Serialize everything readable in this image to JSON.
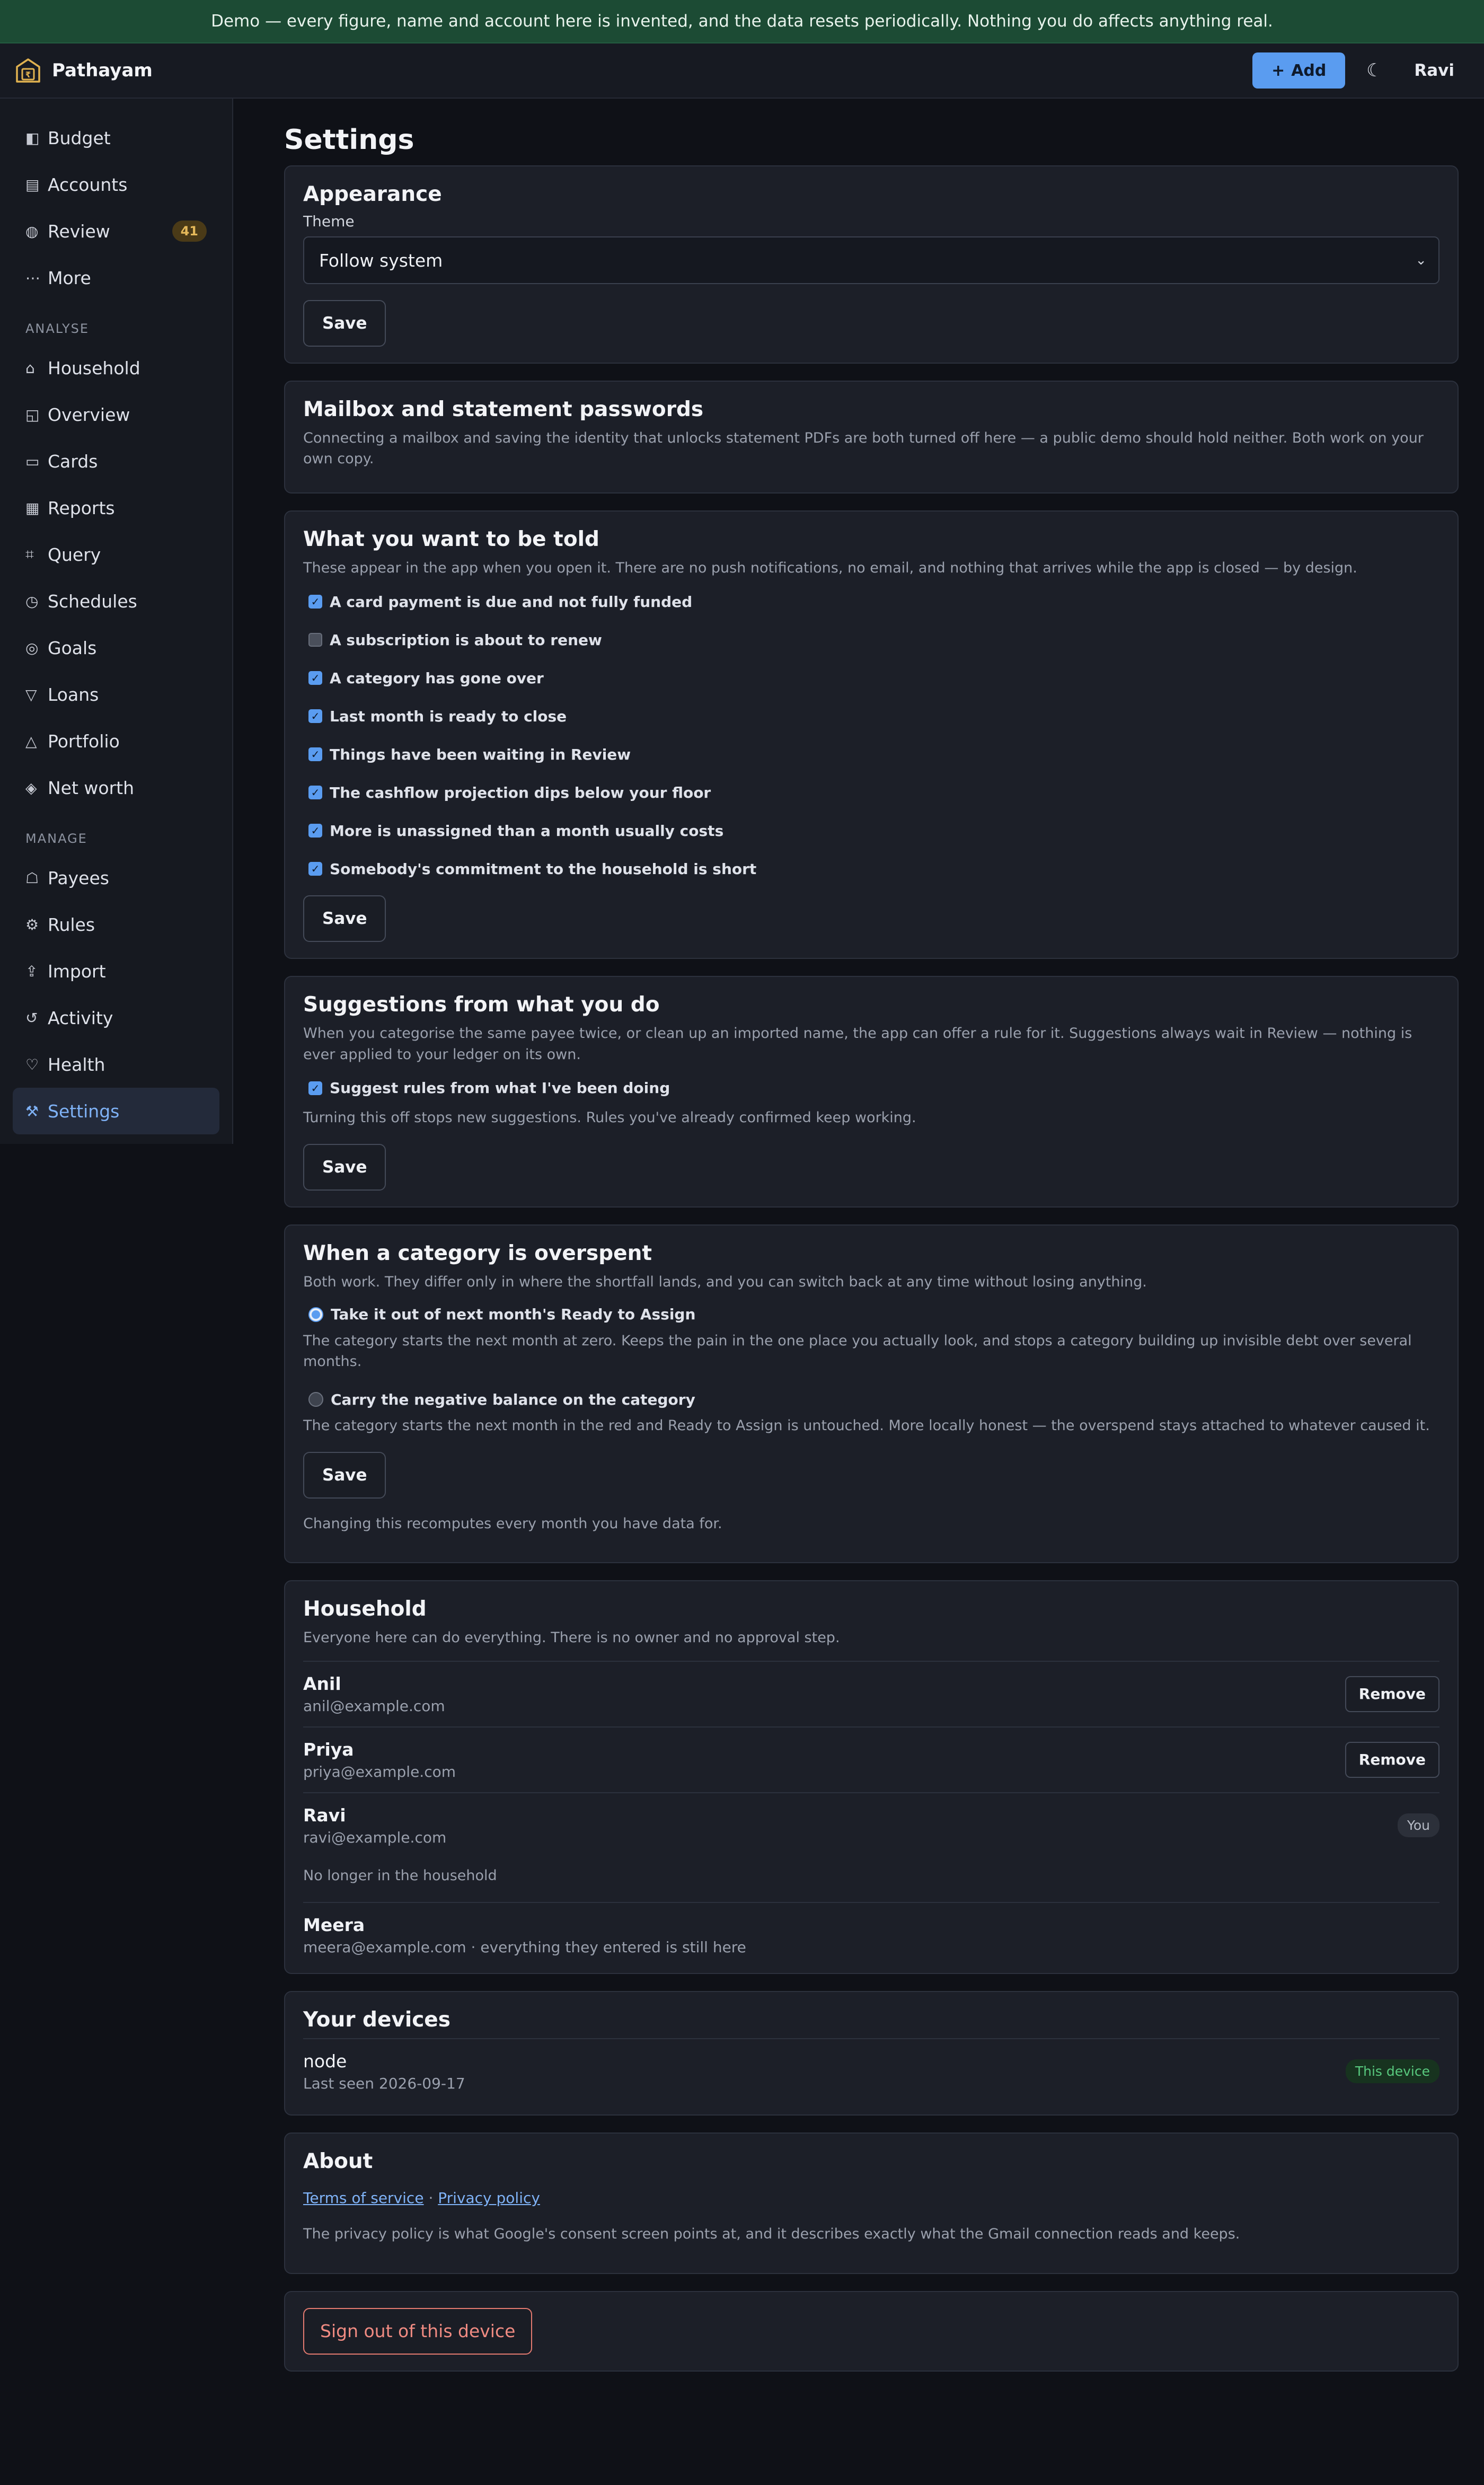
{
  "banner": "Demo — every figure, name and account here is invented, and the data resets periodically. Nothing you do affects anything real.",
  "topbar": {
    "brand": "Pathayam",
    "add_label": "Add",
    "theme_icon": "moon-icon",
    "user": "Ravi"
  },
  "sidebar": {
    "items": [
      {
        "label": "Budget",
        "icon": "budget-icon",
        "glyph": "◧"
      },
      {
        "label": "Accounts",
        "icon": "accounts-icon",
        "glyph": "▤"
      },
      {
        "label": "Review",
        "icon": "review-icon",
        "glyph": "◍",
        "badge": "41"
      },
      {
        "label": "More",
        "icon": "more-icon",
        "glyph": "⋯"
      }
    ],
    "analyse_heading": "ANALYSE",
    "analyse": [
      {
        "label": "Household",
        "glyph": "⌂"
      },
      {
        "label": "Overview",
        "glyph": "◱"
      },
      {
        "label": "Cards",
        "glyph": "▭"
      },
      {
        "label": "Reports",
        "glyph": "▦"
      },
      {
        "label": "Query",
        "glyph": "⌗"
      },
      {
        "label": "Schedules",
        "glyph": "◷"
      },
      {
        "label": "Goals",
        "glyph": "◎"
      },
      {
        "label": "Loans",
        "glyph": "▽"
      },
      {
        "label": "Portfolio",
        "glyph": "△"
      },
      {
        "label": "Net worth",
        "glyph": "◈"
      }
    ],
    "manage_heading": "MANAGE",
    "manage": [
      {
        "label": "Payees",
        "glyph": "☖"
      },
      {
        "label": "Rules",
        "glyph": "⚙"
      },
      {
        "label": "Import",
        "glyph": "⇪"
      },
      {
        "label": "Activity",
        "glyph": "↺"
      },
      {
        "label": "Health",
        "glyph": "♡"
      },
      {
        "label": "Settings",
        "glyph": "⚒",
        "active": true
      }
    ]
  },
  "page": {
    "title": "Settings",
    "appearance": {
      "title": "Appearance",
      "theme_label": "Theme",
      "theme_value": "Follow system",
      "save": "Save"
    },
    "mailbox": {
      "title": "Mailbox and statement passwords",
      "description": "Connecting a mailbox and saving the identity that unlocks statement PDFs are both turned off here — a public demo should hold neither. Both work on your own copy."
    },
    "notify": {
      "title": "What you want to be told",
      "description": "These appear in the app when you open it. There are no push notifications, no email, and nothing that arrives while the app is closed — by design.",
      "options": [
        {
          "label": "A card payment is due and not fully funded",
          "checked": true
        },
        {
          "label": "A subscription is about to renew",
          "checked": false
        },
        {
          "label": "A category has gone over",
          "checked": true
        },
        {
          "label": "Last month is ready to close",
          "checked": true
        },
        {
          "label": "Things have been waiting in Review",
          "checked": true
        },
        {
          "label": "The cashflow projection dips below your floor",
          "checked": true
        },
        {
          "label": "More is unassigned than a month usually costs",
          "checked": true
        },
        {
          "label": "Somebody's commitment to the household is short",
          "checked": true
        }
      ],
      "save": "Save"
    },
    "suggestions": {
      "title": "Suggestions from what you do",
      "description": "When you categorise the same payee twice, or clean up an imported name, the app can offer a rule for it. Suggestions always wait in Review — nothing is ever applied to your ledger on its own.",
      "option": "Suggest rules from what I've been doing",
      "note": "Turning this off stops new suggestions. Rules you've already confirmed keep working.",
      "save": "Save"
    },
    "overspent": {
      "title": "When a category is overspent",
      "description": "Both work. They differ only in where the shortfall lands, and you can switch back at any time without losing anything.",
      "option1": "Take it out of next month's Ready to Assign",
      "option1_desc": "The category starts the next month at zero. Keeps the pain in the one place you actually look, and stops a category building up invisible debt over several months.",
      "option2": "Carry the negative balance on the category",
      "option2_desc": "The category starts the next month in the red and Ready to Assign is untouched. More locally honest — the overspend stays attached to whatever caused it.",
      "save": "Save",
      "note": "Changing this recomputes every month you have data for."
    },
    "household": {
      "title": "Household",
      "description": "Everyone here can do everything. There is no owner and no approval step.",
      "members": [
        {
          "name": "Anil",
          "email": "anil@example.com",
          "action": "Remove"
        },
        {
          "name": "Priya",
          "email": "priya@example.com",
          "action": "Remove"
        },
        {
          "name": "Ravi",
          "email": "ravi@example.com",
          "badge": "You"
        }
      ],
      "former_heading": "No longer in the household",
      "former": {
        "name": "Meera",
        "detail": "meera@example.com · everything they entered is still here"
      }
    },
    "devices": {
      "title": "Your devices",
      "name": "node",
      "last_seen": "Last seen 2026-09-17",
      "badge": "This device"
    },
    "about": {
      "title": "About",
      "terms": "Terms of service",
      "sep": " · ",
      "privacy": "Privacy policy",
      "note": "The privacy policy is what Google's consent screen points at, and it describes exactly what the Gmail connection reads and keeps."
    },
    "signout": "Sign out of this device"
  }
}
